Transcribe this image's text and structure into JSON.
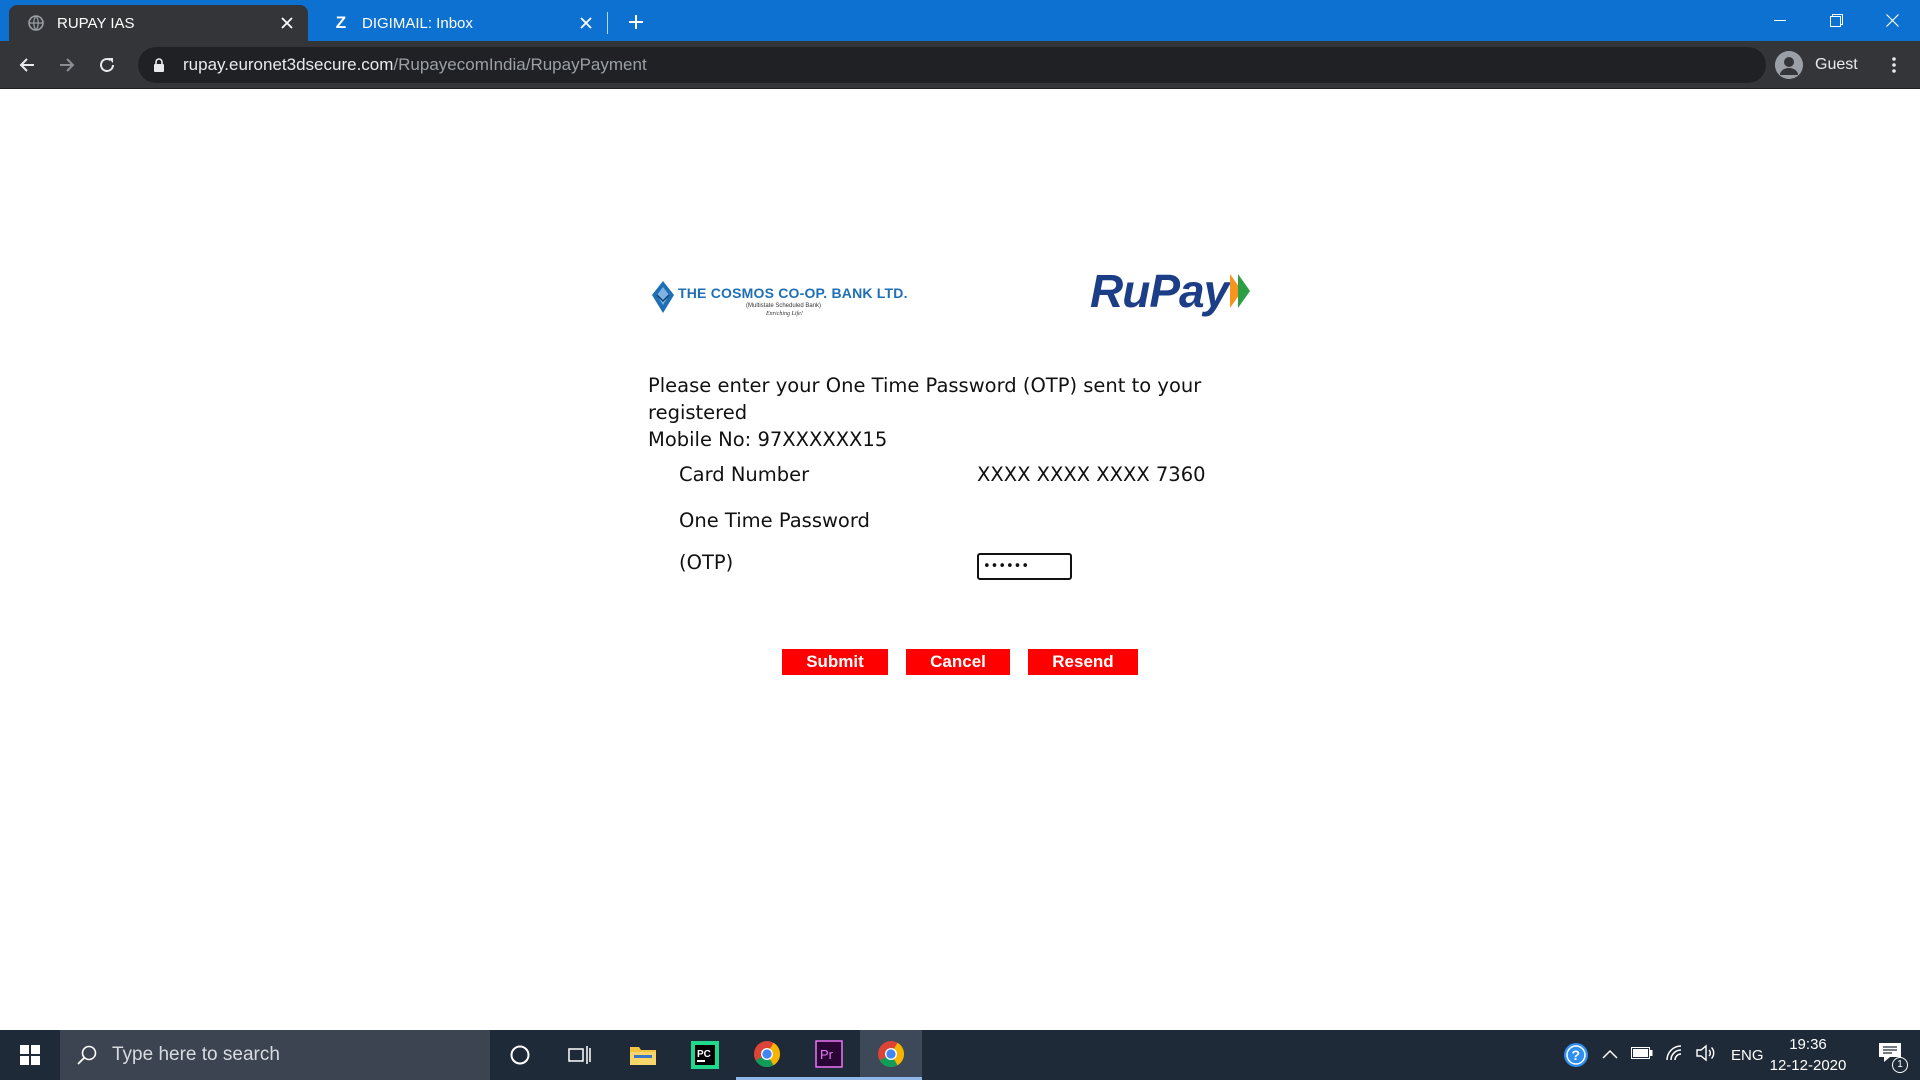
{
  "browser": {
    "tabs": [
      {
        "title": "RUPAY IAS",
        "active": true,
        "favicon": "globe-icon"
      },
      {
        "title": "DIGIMAIL: Inbox",
        "active": false,
        "favicon": "z-icon",
        "favicon_letter": "Z"
      }
    ],
    "url_host": "rupay.euronet3dsecure.com",
    "url_path": "/RupayecomIndia/RupayPayment",
    "profile_label": "Guest"
  },
  "page": {
    "bank_logo": {
      "name": "THE COSMOS CO-OP. BANK LTD.",
      "subtitle": "(Multistate Scheduled Bank)",
      "tagline": "Enriching Life!"
    },
    "network_logo": "RuPay",
    "instruction_line1": "Please enter your One Time Password (OTP) sent to your registered",
    "instruction_line2": "Mobile No: 97XXXXXX15",
    "card_number_label": "Card Number",
    "card_number_value": "XXXX XXXX XXXX 7360",
    "otp_label_line1": "One Time Password",
    "otp_label_line2": "(OTP)",
    "otp_value": "••••••",
    "buttons": {
      "submit": "Submit",
      "cancel": "Cancel",
      "resend": "Resend"
    }
  },
  "taskbar": {
    "search_placeholder": "Type here to search",
    "language": "ENG",
    "time": "19:36",
    "date": "12-12-2020",
    "notification_count": "1",
    "apps": [
      "cortana-icon",
      "task-view-icon",
      "file-explorer-icon",
      "pycharm-icon",
      "chrome-icon",
      "premiere-pro-icon",
      "chrome-icon"
    ]
  },
  "colors": {
    "tabstrip": "#0c71d1",
    "toolbar": "#343538",
    "button_red": "#ff0000",
    "rupay_blue": "#1b3e86",
    "cosmos_blue": "#1f6fb7",
    "taskbar": "#1f2a38"
  }
}
